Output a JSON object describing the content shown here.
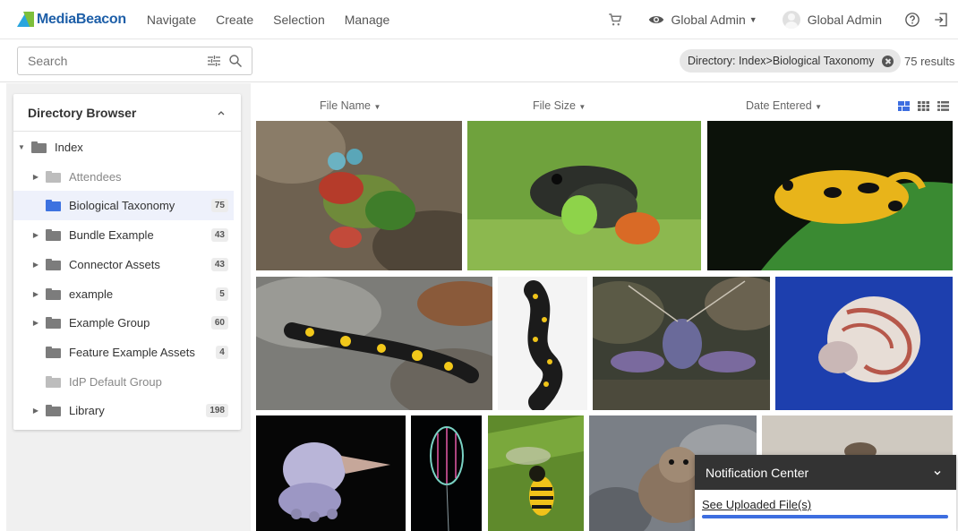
{
  "header": {
    "brand": "MediaBeacon",
    "nav": [
      "Navigate",
      "Create",
      "Selection",
      "Manage"
    ],
    "role_label": "Global Admin",
    "user_label": "Global Admin",
    "icons": [
      "cart-icon",
      "eye-icon",
      "avatar",
      "help-icon",
      "logout-icon"
    ]
  },
  "search": {
    "placeholder": "Search",
    "filter_chip": "Directory: Index>Biological Taxonomy",
    "results_count": "75 results"
  },
  "sidebar": {
    "title": "Directory Browser",
    "items": [
      {
        "label": "Index",
        "count": "",
        "expander": "open",
        "indent": 0,
        "state": "normal"
      },
      {
        "label": "Attendees",
        "count": "",
        "expander": "closed",
        "indent": 1,
        "state": "dim"
      },
      {
        "label": "Biological Taxonomy",
        "count": "75",
        "expander": "none",
        "indent": 1,
        "state": "selected"
      },
      {
        "label": "Bundle Example",
        "count": "43",
        "expander": "closed",
        "indent": 1,
        "state": "normal"
      },
      {
        "label": "Connector Assets",
        "count": "43",
        "expander": "closed",
        "indent": 1,
        "state": "normal"
      },
      {
        "label": "example",
        "count": "5",
        "expander": "closed",
        "indent": 1,
        "state": "normal"
      },
      {
        "label": "Example Group",
        "count": "60",
        "expander": "closed",
        "indent": 1,
        "state": "normal"
      },
      {
        "label": "Feature Example Assets",
        "count": "4",
        "expander": "none",
        "indent": 1,
        "state": "normal"
      },
      {
        "label": "IdP Default Group",
        "count": "",
        "expander": "none",
        "indent": 1,
        "state": "dim"
      },
      {
        "label": "Library",
        "count": "198",
        "expander": "closed",
        "indent": 1,
        "state": "normal"
      }
    ]
  },
  "grid": {
    "sort_columns": [
      "File Name",
      "File Size",
      "Date Entered"
    ],
    "view_modes": [
      "masonry-view-icon",
      "grid-view-icon",
      "list-view-icon"
    ],
    "active_view": "masonry-view-icon",
    "thumbnails": [
      "mantis-shrimp",
      "poison-dart-frog",
      "golden-frog",
      "fire-salamander",
      "spotted-salamander",
      "lobster",
      "nautilus",
      "dumbo-octopus",
      "comb-jelly",
      "wasp",
      "fur-seal",
      "seal"
    ]
  },
  "notification": {
    "title": "Notification Center",
    "link": "See Uploaded File(s)",
    "progress": 1.0
  },
  "colors": {
    "accent": "#3d6ee0",
    "folder": "#7c7c7c",
    "folder_selected": "#3d72e0",
    "selected_row": "#eef1fb",
    "notification_header": "#333333"
  }
}
